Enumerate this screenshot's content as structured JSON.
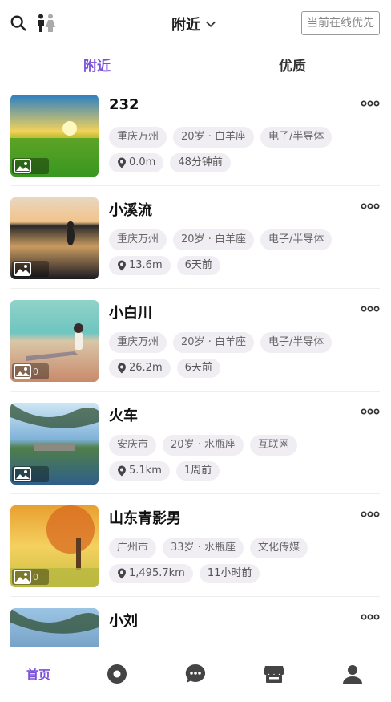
{
  "header": {
    "title": "附近",
    "online_first": "当前在线优先",
    "icons": [
      "search-icon",
      "gender-filter-icon",
      "chevron-down-icon"
    ]
  },
  "tabs": [
    {
      "label": "附近",
      "active": true
    },
    {
      "label": "优质",
      "active": false
    }
  ],
  "users": [
    {
      "name": "232",
      "city": "重庆万州",
      "age_sign": "20岁 · 白羊座",
      "industry": "电子/半导体",
      "distance": "0.0m",
      "time": "48分钟前",
      "photo_count": ""
    },
    {
      "name": "小溪流",
      "city": "重庆万州",
      "age_sign": "20岁 · 白羊座",
      "industry": "电子/半导体",
      "distance": "13.6m",
      "time": "6天前",
      "photo_count": ""
    },
    {
      "name": "小白川",
      "city": "重庆万州",
      "age_sign": "20岁 · 白羊座",
      "industry": "电子/半导体",
      "distance": "26.2m",
      "time": "6天前",
      "photo_count": "0"
    },
    {
      "name": "火车",
      "city": "安庆市",
      "age_sign": "20岁 · 水瓶座",
      "industry": "互联网",
      "distance": "5.1km",
      "time": "1周前",
      "photo_count": ""
    },
    {
      "name": "山东青影男",
      "city": "广州市",
      "age_sign": "33岁 · 水瓶座",
      "industry": "文化传媒",
      "distance": "1,495.7km",
      "time": "11小时前",
      "photo_count": "0"
    },
    {
      "name": "小刘",
      "city": "",
      "age_sign": "",
      "industry": "",
      "distance": "",
      "time": "",
      "photo_count": ""
    }
  ],
  "bottom_nav": {
    "home_label": "首页",
    "icons": [
      "discover-icon",
      "message-icon",
      "shop-icon",
      "profile-icon"
    ]
  },
  "colors": {
    "accent": "#7a4fd8",
    "tag_bg": "#f0eef3",
    "nav_icon": "#444444"
  }
}
